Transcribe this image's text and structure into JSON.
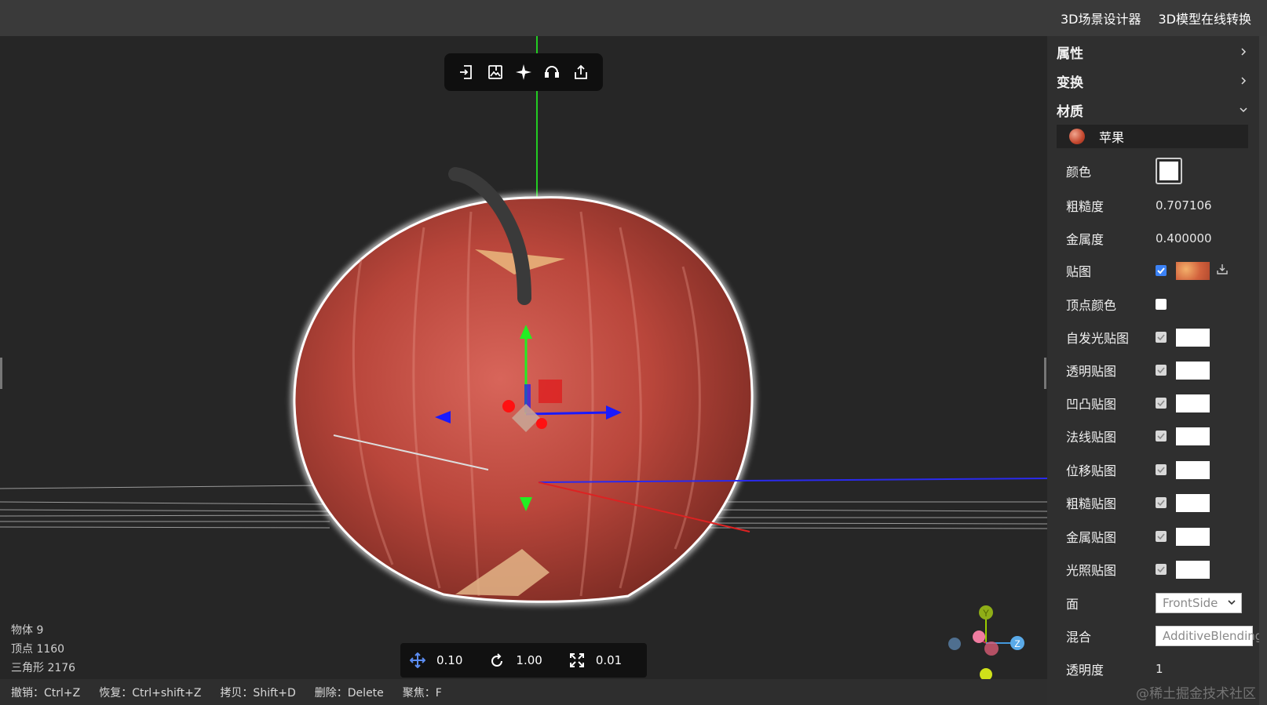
{
  "header": {
    "links": [
      "3D场景设计器",
      "3D模型在线转换"
    ]
  },
  "toolbar": {
    "icons": [
      "import-icon",
      "image-import-icon",
      "focus-icon",
      "support-icon",
      "export-icon"
    ]
  },
  "stats": {
    "objects": "物体 9",
    "vertices": "顶点 1160",
    "triangles": "三角形 2176"
  },
  "snap": {
    "move_value": "0.10",
    "rotate_value": "1.00",
    "scale_value": "0.01"
  },
  "shortcuts": [
    "撤销：Ctrl+Z",
    "恢复：Ctrl+shift+Z",
    "拷贝：Shift+D",
    "删除：Delete",
    "聚焦：F"
  ],
  "panel": {
    "sections": {
      "properties": "属性",
      "transform": "变换",
      "material": "材质"
    },
    "material_name": "苹果",
    "color_label": "颜色",
    "roughness_label": "粗糙度",
    "roughness_value": "0.707106",
    "metalness_label": "金属度",
    "metalness_value": "0.400000",
    "map_label": "贴图",
    "vertex_colors_label": "顶点颜色",
    "maps": [
      "自发光贴图",
      "透明贴图",
      "凹凸贴图",
      "法线贴图",
      "位移贴图",
      "粗糙贴图",
      "金属贴图",
      "光照贴图"
    ],
    "side_label": "面",
    "side_value": "FrontSide",
    "blending_label": "混合",
    "blending_value": "AdditiveBlending",
    "opacity_label": "透明度",
    "opacity_value": "1"
  },
  "colors": {
    "accent": "#3b82f6",
    "apple": "#c4472e",
    "axis_x": "#1a1aff",
    "axis_y": "#22cc22",
    "axis_z": "#ee2222"
  },
  "gizmo_labels": {
    "y": "Y",
    "z": "Z"
  },
  "watermark": "@稀土掘金技术社区"
}
